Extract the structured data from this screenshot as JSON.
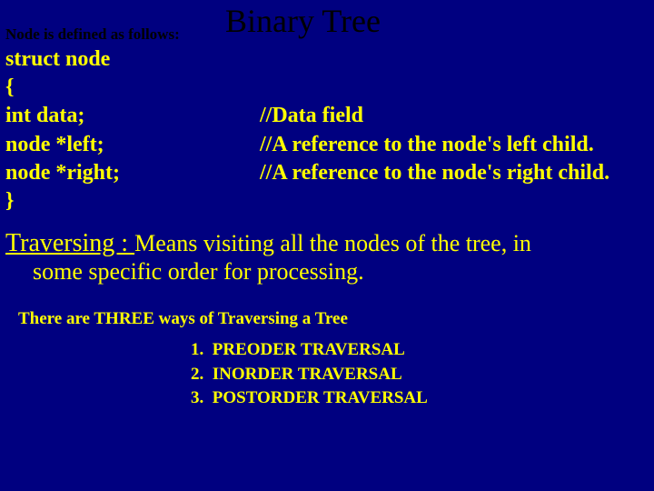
{
  "title": "Binary Tree",
  "subtitle": "Node is defined as follows:",
  "struct": {
    "line1": "struct node",
    "line2": "{",
    "field1": "int data;",
    "comment1": "//Data field",
    "field2": "node *left;",
    "comment2": "//A reference to the node's left child.",
    "field3": "node *right;",
    "comment3": "//A reference to the node's right child.",
    "line6": "}"
  },
  "traversing": {
    "heading": "Traversing : ",
    "text1": "Means visiting all the nodes of the tree, in",
    "text2": "some specific order for processing."
  },
  "threeWays": "There are THREE ways of Traversing a Tree",
  "list": {
    "item1": "1.  PREODER TRAVERSAL",
    "item2": "2.  INORDER TRAVERSAL",
    "item3": "3.  POSTORDER TRAVERSAL"
  }
}
